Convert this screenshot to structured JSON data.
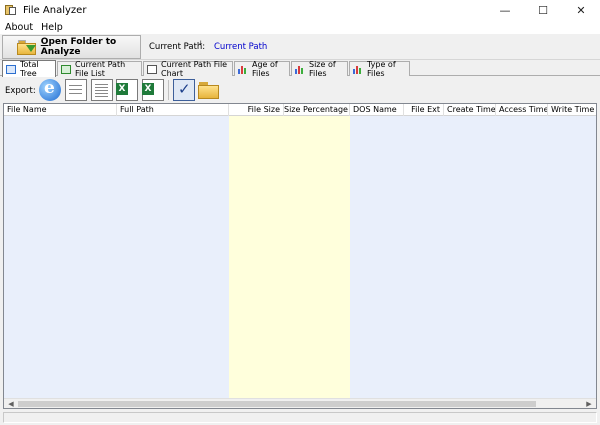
{
  "window": {
    "title": "File Analyzer",
    "minimize_glyph": "—",
    "maximize_glyph": "☐",
    "close_glyph": "✕"
  },
  "menu": {
    "items": [
      "About",
      "Help"
    ]
  },
  "toolbar": {
    "open_button_label": "Open Folder to Analyze",
    "open_button_hotkey": "O",
    "open_button_rest": "pen Folder to Analyze",
    "current_path_label": "Current Path:",
    "current_path_separator": "ꜜ",
    "current_path_value": "Current Path"
  },
  "tabs": [
    {
      "label": "Total Tree",
      "icon": "tree-icon",
      "active": true
    },
    {
      "label": "Current Path File List",
      "icon": "list-icon",
      "active": false
    },
    {
      "label": "Current Path File Chart",
      "icon": "chart-icon",
      "active": false
    },
    {
      "label": "Age of Files",
      "icon": "bar-chart-icon",
      "active": false
    },
    {
      "label": "Size of Files",
      "icon": "bar-chart-icon",
      "active": false
    },
    {
      "label": "Type of Files",
      "icon": "bar-chart-icon",
      "active": false
    }
  ],
  "export": {
    "label": "Export:",
    "icons": [
      "html-export-icon",
      "web-export-icon",
      "text-export-icon",
      "excel-export-icon",
      "csv-export-icon",
      "check-icon",
      "folder-icon"
    ]
  },
  "grid": {
    "columns": [
      "File Name",
      "Full Path",
      "File Size",
      "Size Percentage",
      "DOS Name",
      "File Ext",
      "Create Time",
      "Access Time",
      "Write Time"
    ],
    "rows": [],
    "highlight_color": "#ffffdc",
    "background_color": "#e9effb"
  },
  "scrollbar": {
    "left_arrow": "◀",
    "right_arrow": "▶"
  }
}
